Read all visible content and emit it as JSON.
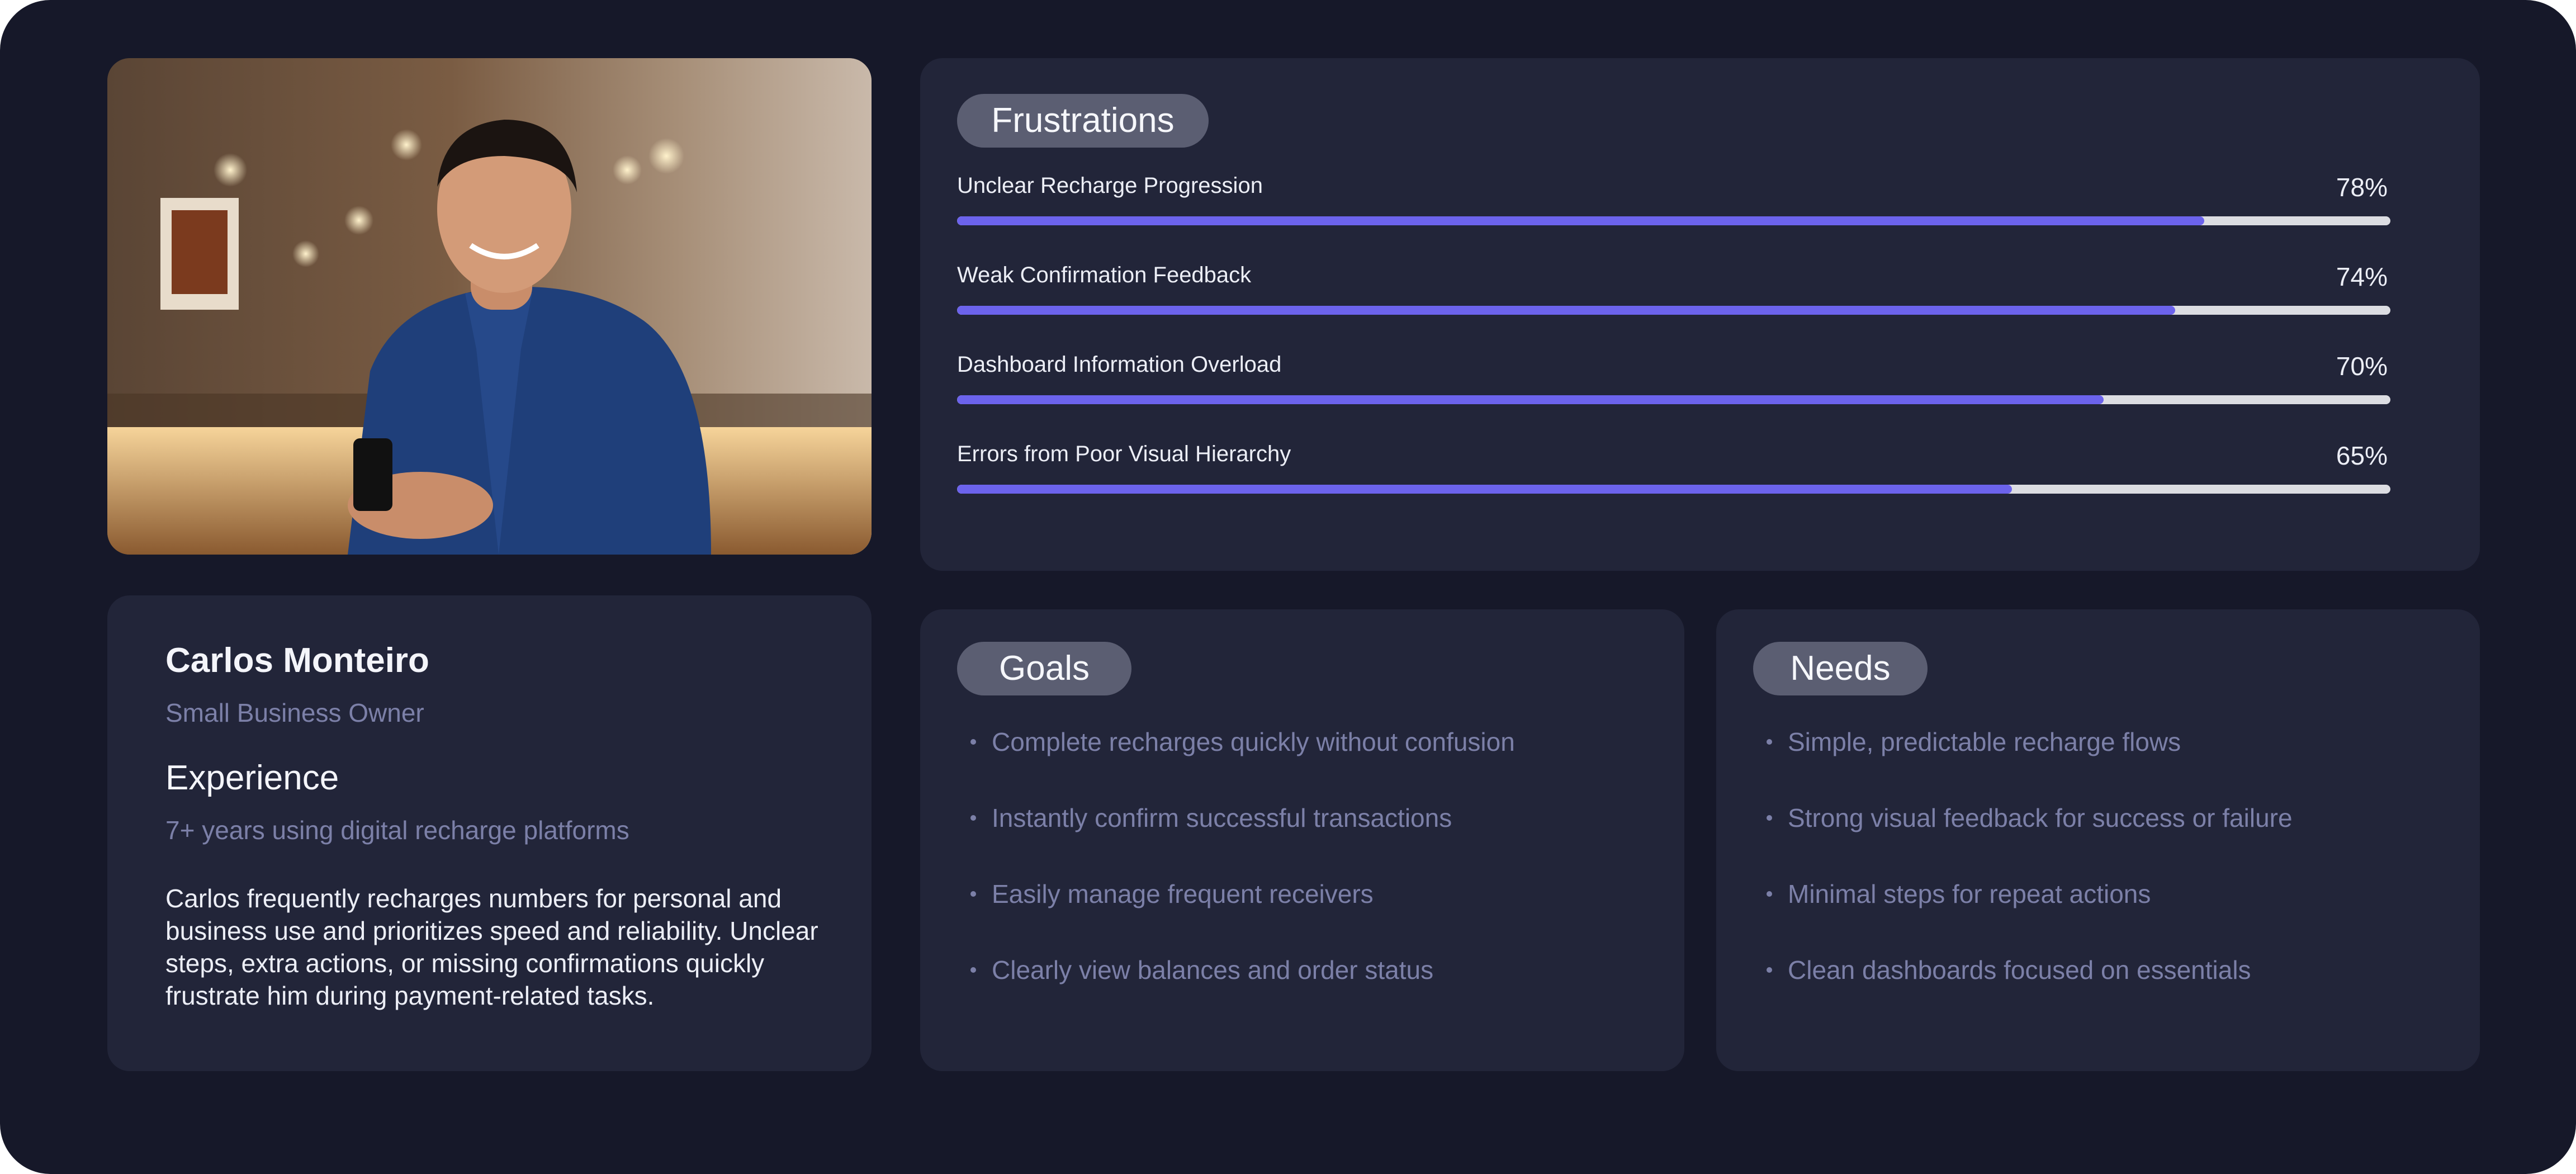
{
  "profile": {
    "name": "Carlos Monteiro",
    "role": "Small Business Owner",
    "experience_heading": "Experience",
    "experience_value": "7+ years using digital recharge platforms",
    "bio": "Carlos frequently recharges numbers for personal and business use and prioritizes speed and reliability. Unclear steps, extra actions, or missing confirmations quickly frustrate him during payment-related tasks."
  },
  "frustrations": {
    "title": "Frustrations",
    "items": [
      {
        "label": "Unclear Recharge Progression",
        "percent_text": "78%",
        "value": 0.87
      },
      {
        "label": "Weak Confirmation Feedback",
        "percent_text": "74%",
        "value": 0.85
      },
      {
        "label": "Dashboard Information Overload",
        "percent_text": "70%",
        "value": 0.8
      },
      {
        "label": "Errors from Poor Visual Hierarchy",
        "percent_text": "65%",
        "value": 0.736
      }
    ]
  },
  "goals": {
    "title": "Goals",
    "items": [
      "Complete recharges quickly without confusion",
      "Instantly confirm successful transactions",
      "Easily manage frequent receivers",
      "Clearly view balances and order status"
    ]
  },
  "needs": {
    "title": "Needs",
    "items": [
      "Simple, predictable recharge flows",
      "Strong visual feedback for success or failure",
      "Minimal steps for repeat actions",
      "Clean dashboards focused on essentials"
    ]
  },
  "colors": {
    "page_bg": "#161829",
    "card_bg": "#222539",
    "accent": "#6c63ec",
    "track": "#dcdde2",
    "pill": "#5b5e72",
    "muted_text": "#7c80a8"
  }
}
